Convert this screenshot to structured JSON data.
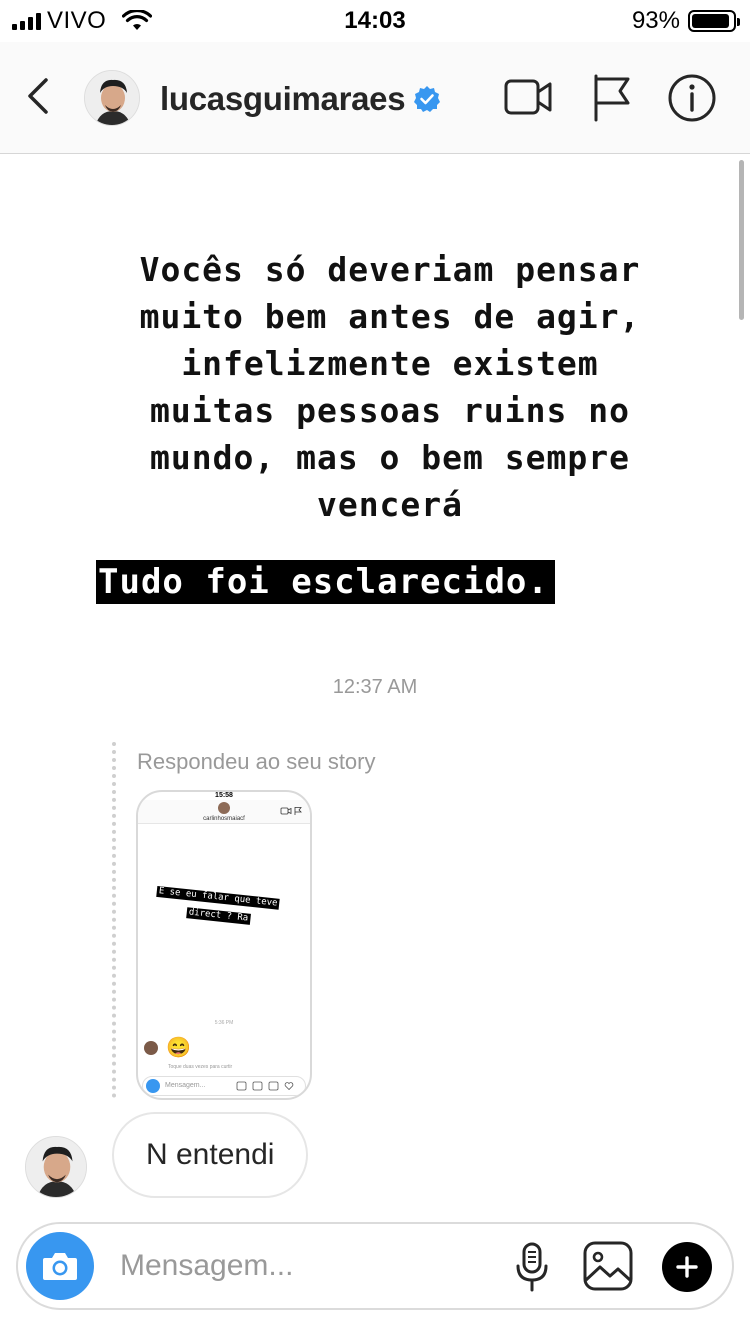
{
  "status_bar": {
    "carrier": "VIVO",
    "time": "14:03",
    "battery_text": "93%",
    "battery_level": 0.93,
    "icons": [
      "signal-icon",
      "wifi-icon",
      "battery-icon"
    ]
  },
  "header": {
    "username": "lucasguimaraes",
    "verified": true,
    "icons": [
      "back-icon",
      "video-call-icon",
      "flag-icon",
      "info-icon"
    ],
    "accent_color": "#3897f0"
  },
  "story": {
    "text": "Vocês só deveriam pensar\nmuito bem antes de agir,\ninfelizmente existem\nmuitas pessoas ruins no\nmundo, mas o bem sempre\nvencerá",
    "highlight": "Tudo foi esclarecido."
  },
  "timestamp": "12:37 AM",
  "reply": {
    "label": "Respondeu ao seu story",
    "thumbnail": {
      "time": "15:58",
      "username": "carlinhosmaiacf",
      "story_text": [
        "E se eu falar que teve",
        "direct ? Ra"
      ],
      "timestamp": "5:36 PM",
      "emoji": "😄",
      "like_hint": "Toque duas vezes para curtir",
      "placeholder": "Mensagem..."
    }
  },
  "message": {
    "text": "N entendi"
  },
  "composer": {
    "placeholder": "Mensagem...",
    "icons": [
      "camera-icon",
      "microphone-icon",
      "gallery-icon",
      "plus-icon"
    ]
  }
}
